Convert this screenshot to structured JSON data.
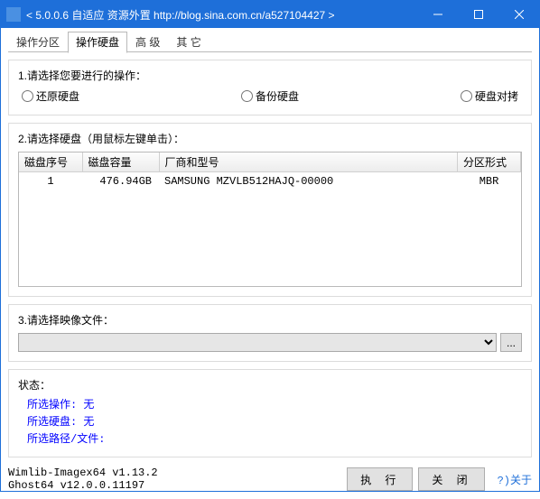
{
  "window": {
    "title": "< 5.0.0.6 自适应 资源外置 http://blog.sina.com.cn/a527104427 >"
  },
  "tabs": {
    "items": [
      "操作分区",
      "操作硬盘",
      "高 级",
      "其 它"
    ],
    "active_index": 1
  },
  "section1": {
    "label": "1.请选择您要进行的操作：",
    "options": [
      "还原硬盘",
      "备份硬盘",
      "硬盘对拷"
    ]
  },
  "section2": {
    "label": "2.请选择硬盘（用鼠标左键单击）：",
    "columns": [
      "磁盘序号",
      "磁盘容量",
      "厂商和型号",
      "分区形式"
    ],
    "rows": [
      {
        "seq": "1",
        "cap": "476.94GB",
        "vendor": "SAMSUNG MZVLB512HAJQ-00000",
        "part": "MBR"
      }
    ]
  },
  "section3": {
    "label": "3.请选择映像文件：",
    "browse": "..."
  },
  "status": {
    "title": "状态：",
    "op_label": "所选操作:",
    "op_value": "无",
    "disk_label": "所选硬盘:",
    "disk_value": "无",
    "path_label": "所选路径/文件:",
    "path_value": ""
  },
  "footer": {
    "line1": "Wimlib-Imagex64 v1.13.2",
    "line2": "Ghost64 v12.0.0.11197",
    "execute": "执 行",
    "close": "关 闭",
    "about": "?)关于"
  }
}
